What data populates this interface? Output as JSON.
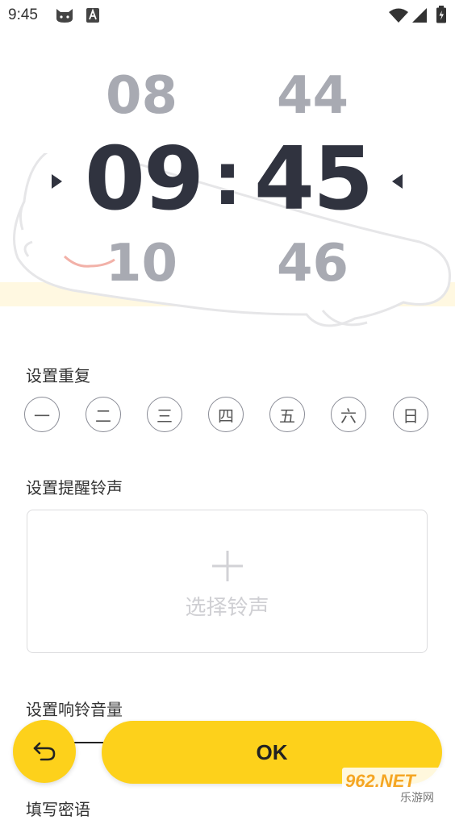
{
  "status_bar": {
    "time": "9:45"
  },
  "picker": {
    "hour_prev": "08",
    "hour_current": "09",
    "hour_next": "10",
    "separator": ":",
    "minute_prev": "44",
    "minute_current": "45",
    "minute_next": "46"
  },
  "repeat": {
    "label": "设置重复",
    "days": [
      "一",
      "二",
      "三",
      "四",
      "五",
      "六",
      "日"
    ]
  },
  "ringtone": {
    "label": "设置提醒铃声",
    "select_label": "选择铃声"
  },
  "volume": {
    "label": "设置响铃音量"
  },
  "password": {
    "label": "填写密语"
  },
  "actions": {
    "ok_label": "OK"
  },
  "watermark": {
    "text_top": "962.NET",
    "text_bottom": "乐游网"
  },
  "colors": {
    "accent": "#fdd11b",
    "digit_dark": "#30333f",
    "digit_light": "#a8aab2"
  }
}
